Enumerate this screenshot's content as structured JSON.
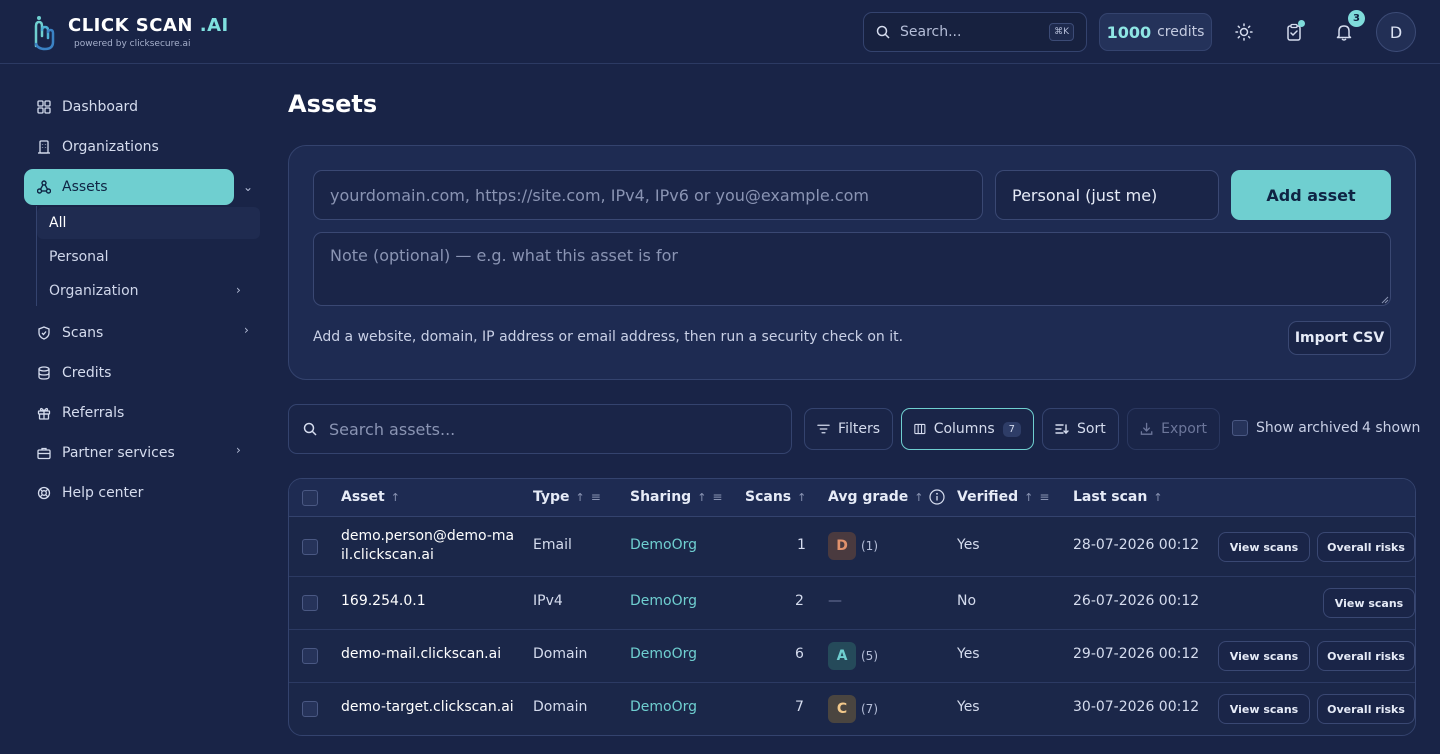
{
  "brand": {
    "title_main": "CLICK SCAN",
    "title_suffix": ".AI",
    "subtitle": "powered by clicksecure.ai"
  },
  "header": {
    "search_label": "Search...",
    "search_shortcut": "⌘K",
    "credits_value": "1000",
    "credits_label": "credits",
    "notifications_count": "3",
    "avatar_initial": "D"
  },
  "sidebar": {
    "items": [
      {
        "label": "Dashboard",
        "icon": "grid-icon"
      },
      {
        "label": "Organizations",
        "icon": "building-icon"
      },
      {
        "label": "Assets",
        "icon": "network-icon",
        "active": true
      },
      {
        "label": "Scans",
        "icon": "shield-icon"
      },
      {
        "label": "Credits",
        "icon": "database-icon"
      },
      {
        "label": "Referrals",
        "icon": "gift-icon"
      },
      {
        "label": "Partner services",
        "icon": "briefcase-icon"
      },
      {
        "label": "Help center",
        "icon": "lifebuoy-icon"
      }
    ],
    "assets_sub": [
      "All",
      "Personal",
      "Organization"
    ]
  },
  "main": {
    "page_title": "Assets",
    "add_form": {
      "target_placeholder": "yourdomain.com, https://site.com, IPv4, IPv6 or you@example.com",
      "scope_value": "Personal (just me)",
      "add_button": "Add asset",
      "note_placeholder": "Note (optional) — e.g. what this asset is for",
      "helper_text": "Add a website, domain, IP address or email address, then run a security check on it.",
      "import_button": "Import CSV"
    },
    "toolbar": {
      "search_placeholder": "Search assets...",
      "filters": "Filters",
      "columns": "Columns",
      "columns_count": "7",
      "sort": "Sort",
      "export": "Export",
      "show_archived": "Show archived",
      "shown": "4 shown"
    },
    "table": {
      "columns": [
        "Asset",
        "Type",
        "Sharing",
        "Scans",
        "Avg grade",
        "Verified",
        "Last scan"
      ],
      "rows": [
        {
          "asset": "demo.person@demo-mail.clickscan.ai",
          "asset_l1": "demo.person@demo-ma",
          "asset_l2": "il.clickscan.ai",
          "type": "Email",
          "sharing": "DemoOrg",
          "scans": "1",
          "grade": "D",
          "grade_count": "(1)",
          "verified": "Yes",
          "last_scan": "28-07-2026 00:12",
          "view": "View scans",
          "risks": "Overall risks"
        },
        {
          "asset": "169.254.0.1",
          "type": "IPv4",
          "sharing": "DemoOrg",
          "scans": "2",
          "grade": "—",
          "verified": "No",
          "last_scan": "26-07-2026 00:12",
          "view": "View scans"
        },
        {
          "asset": "demo-mail.clickscan.ai",
          "type": "Domain",
          "sharing": "DemoOrg",
          "scans": "6",
          "grade": "A",
          "grade_count": "(5)",
          "verified": "Yes",
          "last_scan": "29-07-2026 00:12",
          "view": "View scans",
          "risks": "Overall risks"
        },
        {
          "asset": "demo-target.clickscan.ai",
          "type": "Domain",
          "sharing": "DemoOrg",
          "scans": "7",
          "grade": "C",
          "grade_count": "(7)",
          "verified": "Yes",
          "last_scan": "30-07-2026 00:12",
          "view": "View scans",
          "risks": "Overall risks"
        }
      ]
    }
  },
  "colors": {
    "background": "#192447",
    "accent": "#6fcfd0",
    "grade_d": "#e0916c",
    "grade_a": "#6fcfd0",
    "grade_c": "#f2c88a"
  }
}
